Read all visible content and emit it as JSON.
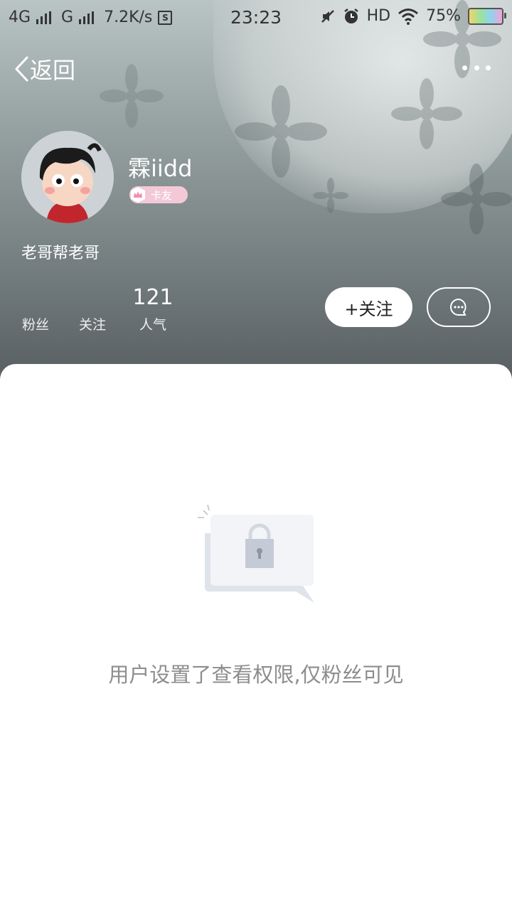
{
  "status_bar": {
    "network_1": "4G",
    "network_2": "G",
    "speed": "7.2K/s",
    "sim_icon": "S",
    "time": "23:23",
    "hd": "HD",
    "battery": "75%"
  },
  "nav": {
    "back_label": "返回"
  },
  "profile": {
    "username": "霖iidd",
    "badge": "卡友",
    "bio": "老哥帮老哥",
    "stats": [
      {
        "value": "",
        "label": "粉丝"
      },
      {
        "value": "",
        "label": "关注"
      },
      {
        "value": "121",
        "label": "人气"
      }
    ]
  },
  "actions": {
    "follow_label": "+关注"
  },
  "empty_state": {
    "message": "用户设置了查看权限,仅粉丝可见"
  },
  "icons": {
    "back": "chevron-left-icon",
    "more": "more-dots-icon",
    "message": "chat-bubble-icon",
    "lock": "lock-icon",
    "crown": "crown-icon"
  },
  "colors": {
    "header_top": "#b9c4c4",
    "header_bottom": "#535a5d",
    "badge_pink": "#f3c9d7",
    "empty_text": "#8d8d8d"
  }
}
